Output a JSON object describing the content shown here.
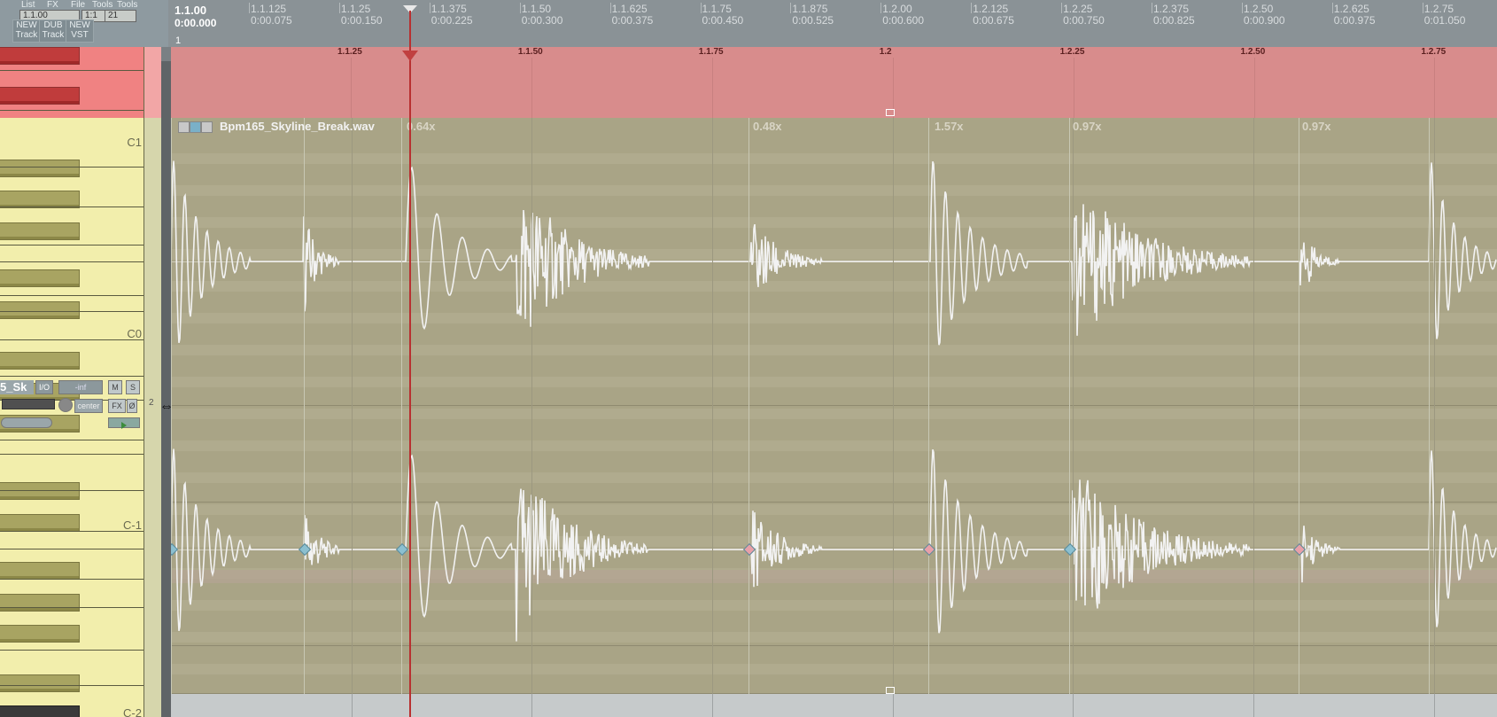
{
  "toolbar": {
    "menu_items": [
      "List",
      "FX",
      "File",
      "Tools",
      "Tools"
    ],
    "position": "1.1.00",
    "grid_value": "1:1",
    "grid_value_2": "21",
    "buttons": [
      {
        "line1": "NEW",
        "line2": "Track"
      },
      {
        "line1": "DUB",
        "line2": "Track"
      },
      {
        "line1": "NEW",
        "line2": "VST"
      }
    ]
  },
  "ruler": {
    "start_beat": "1.1.00",
    "start_time": "0:00.000",
    "ticks": [
      {
        "beat": "1.1.125",
        "time": "0:00.075"
      },
      {
        "beat": "1.1.25",
        "time": "0:00.150"
      },
      {
        "beat": "1.1.375",
        "time": "0:00.225"
      },
      {
        "beat": "1.1.50",
        "time": "0:00.300"
      },
      {
        "beat": "1.1.625",
        "time": "0:00.375"
      },
      {
        "beat": "1.1.75",
        "time": "0:00.450"
      },
      {
        "beat": "1.1.875",
        "time": "0:00.525"
      },
      {
        "beat": "1.2.00",
        "time": "0:00.600"
      },
      {
        "beat": "1.2.125",
        "time": "0:00.675"
      },
      {
        "beat": "1.2.25",
        "time": "0:00.750"
      },
      {
        "beat": "1.2.375",
        "time": "0:00.825"
      },
      {
        "beat": "1.2.50",
        "time": "0:00.900"
      },
      {
        "beat": "1.2.625",
        "time": "0:00.975"
      },
      {
        "beat": "1.2.75",
        "time": "0:01.050"
      }
    ],
    "row_label": "1"
  },
  "loop_bar": {
    "labels": [
      "1.1.25",
      "1.1.50",
      "1.1.75",
      "1.2",
      "1.2.25",
      "1.2.50",
      "1.2.75"
    ]
  },
  "piano": {
    "note_labels": [
      "C1",
      "C0",
      "C-1",
      "C-2"
    ]
  },
  "track": {
    "name": "5_Sk",
    "io_label": "I/O",
    "volume": "-inf",
    "mute": "M",
    "solo": "S",
    "pan": "center",
    "fx": "FX",
    "fx2": "Ø",
    "extra": "2"
  },
  "item": {
    "title": "Bpm165_Skyline_Break.wav",
    "rates": [
      "0.64x",
      "0.48x",
      "1.57x",
      "0.97x",
      "0.97x"
    ]
  },
  "colors": {
    "loop_red": "#d88c8c",
    "item_bg": "#a9a486",
    "waveform": "#f2f2f2",
    "playhead": "#b83030",
    "piano_bg": "#f2eeac"
  }
}
